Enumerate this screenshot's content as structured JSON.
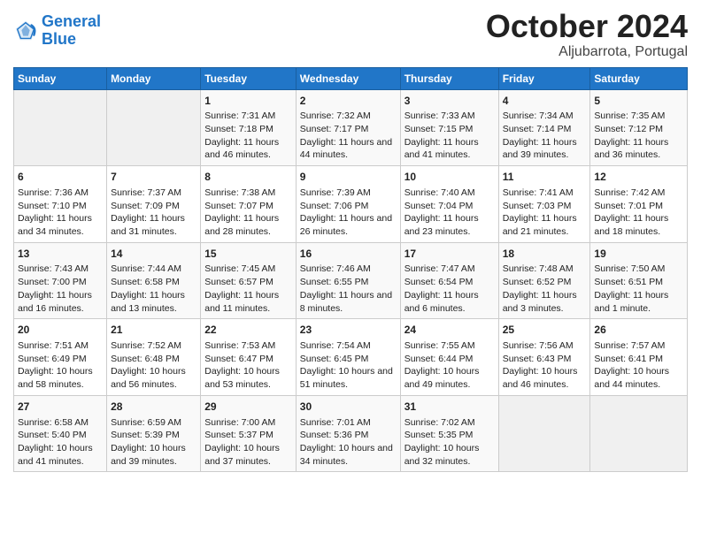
{
  "header": {
    "logo_line1": "General",
    "logo_line2": "Blue",
    "month": "October 2024",
    "location": "Aljubarrota, Portugal"
  },
  "weekdays": [
    "Sunday",
    "Monday",
    "Tuesday",
    "Wednesday",
    "Thursday",
    "Friday",
    "Saturday"
  ],
  "weeks": [
    [
      {
        "day": "",
        "empty": true
      },
      {
        "day": "",
        "empty": true
      },
      {
        "day": "1",
        "sunrise": "Sunrise: 7:31 AM",
        "sunset": "Sunset: 7:18 PM",
        "daylight": "Daylight: 11 hours and 46 minutes."
      },
      {
        "day": "2",
        "sunrise": "Sunrise: 7:32 AM",
        "sunset": "Sunset: 7:17 PM",
        "daylight": "Daylight: 11 hours and 44 minutes."
      },
      {
        "day": "3",
        "sunrise": "Sunrise: 7:33 AM",
        "sunset": "Sunset: 7:15 PM",
        "daylight": "Daylight: 11 hours and 41 minutes."
      },
      {
        "day": "4",
        "sunrise": "Sunrise: 7:34 AM",
        "sunset": "Sunset: 7:14 PM",
        "daylight": "Daylight: 11 hours and 39 minutes."
      },
      {
        "day": "5",
        "sunrise": "Sunrise: 7:35 AM",
        "sunset": "Sunset: 7:12 PM",
        "daylight": "Daylight: 11 hours and 36 minutes."
      }
    ],
    [
      {
        "day": "6",
        "sunrise": "Sunrise: 7:36 AM",
        "sunset": "Sunset: 7:10 PM",
        "daylight": "Daylight: 11 hours and 34 minutes."
      },
      {
        "day": "7",
        "sunrise": "Sunrise: 7:37 AM",
        "sunset": "Sunset: 7:09 PM",
        "daylight": "Daylight: 11 hours and 31 minutes."
      },
      {
        "day": "8",
        "sunrise": "Sunrise: 7:38 AM",
        "sunset": "Sunset: 7:07 PM",
        "daylight": "Daylight: 11 hours and 28 minutes."
      },
      {
        "day": "9",
        "sunrise": "Sunrise: 7:39 AM",
        "sunset": "Sunset: 7:06 PM",
        "daylight": "Daylight: 11 hours and 26 minutes."
      },
      {
        "day": "10",
        "sunrise": "Sunrise: 7:40 AM",
        "sunset": "Sunset: 7:04 PM",
        "daylight": "Daylight: 11 hours and 23 minutes."
      },
      {
        "day": "11",
        "sunrise": "Sunrise: 7:41 AM",
        "sunset": "Sunset: 7:03 PM",
        "daylight": "Daylight: 11 hours and 21 minutes."
      },
      {
        "day": "12",
        "sunrise": "Sunrise: 7:42 AM",
        "sunset": "Sunset: 7:01 PM",
        "daylight": "Daylight: 11 hours and 18 minutes."
      }
    ],
    [
      {
        "day": "13",
        "sunrise": "Sunrise: 7:43 AM",
        "sunset": "Sunset: 7:00 PM",
        "daylight": "Daylight: 11 hours and 16 minutes."
      },
      {
        "day": "14",
        "sunrise": "Sunrise: 7:44 AM",
        "sunset": "Sunset: 6:58 PM",
        "daylight": "Daylight: 11 hours and 13 minutes."
      },
      {
        "day": "15",
        "sunrise": "Sunrise: 7:45 AM",
        "sunset": "Sunset: 6:57 PM",
        "daylight": "Daylight: 11 hours and 11 minutes."
      },
      {
        "day": "16",
        "sunrise": "Sunrise: 7:46 AM",
        "sunset": "Sunset: 6:55 PM",
        "daylight": "Daylight: 11 hours and 8 minutes."
      },
      {
        "day": "17",
        "sunrise": "Sunrise: 7:47 AM",
        "sunset": "Sunset: 6:54 PM",
        "daylight": "Daylight: 11 hours and 6 minutes."
      },
      {
        "day": "18",
        "sunrise": "Sunrise: 7:48 AM",
        "sunset": "Sunset: 6:52 PM",
        "daylight": "Daylight: 11 hours and 3 minutes."
      },
      {
        "day": "19",
        "sunrise": "Sunrise: 7:50 AM",
        "sunset": "Sunset: 6:51 PM",
        "daylight": "Daylight: 11 hours and 1 minute."
      }
    ],
    [
      {
        "day": "20",
        "sunrise": "Sunrise: 7:51 AM",
        "sunset": "Sunset: 6:49 PM",
        "daylight": "Daylight: 10 hours and 58 minutes."
      },
      {
        "day": "21",
        "sunrise": "Sunrise: 7:52 AM",
        "sunset": "Sunset: 6:48 PM",
        "daylight": "Daylight: 10 hours and 56 minutes."
      },
      {
        "day": "22",
        "sunrise": "Sunrise: 7:53 AM",
        "sunset": "Sunset: 6:47 PM",
        "daylight": "Daylight: 10 hours and 53 minutes."
      },
      {
        "day": "23",
        "sunrise": "Sunrise: 7:54 AM",
        "sunset": "Sunset: 6:45 PM",
        "daylight": "Daylight: 10 hours and 51 minutes."
      },
      {
        "day": "24",
        "sunrise": "Sunrise: 7:55 AM",
        "sunset": "Sunset: 6:44 PM",
        "daylight": "Daylight: 10 hours and 49 minutes."
      },
      {
        "day": "25",
        "sunrise": "Sunrise: 7:56 AM",
        "sunset": "Sunset: 6:43 PM",
        "daylight": "Daylight: 10 hours and 46 minutes."
      },
      {
        "day": "26",
        "sunrise": "Sunrise: 7:57 AM",
        "sunset": "Sunset: 6:41 PM",
        "daylight": "Daylight: 10 hours and 44 minutes."
      }
    ],
    [
      {
        "day": "27",
        "sunrise": "Sunrise: 6:58 AM",
        "sunset": "Sunset: 5:40 PM",
        "daylight": "Daylight: 10 hours and 41 minutes."
      },
      {
        "day": "28",
        "sunrise": "Sunrise: 6:59 AM",
        "sunset": "Sunset: 5:39 PM",
        "daylight": "Daylight: 10 hours and 39 minutes."
      },
      {
        "day": "29",
        "sunrise": "Sunrise: 7:00 AM",
        "sunset": "Sunset: 5:37 PM",
        "daylight": "Daylight: 10 hours and 37 minutes."
      },
      {
        "day": "30",
        "sunrise": "Sunrise: 7:01 AM",
        "sunset": "Sunset: 5:36 PM",
        "daylight": "Daylight: 10 hours and 34 minutes."
      },
      {
        "day": "31",
        "sunrise": "Sunrise: 7:02 AM",
        "sunset": "Sunset: 5:35 PM",
        "daylight": "Daylight: 10 hours and 32 minutes."
      },
      {
        "day": "",
        "empty": true
      },
      {
        "day": "",
        "empty": true
      }
    ]
  ]
}
